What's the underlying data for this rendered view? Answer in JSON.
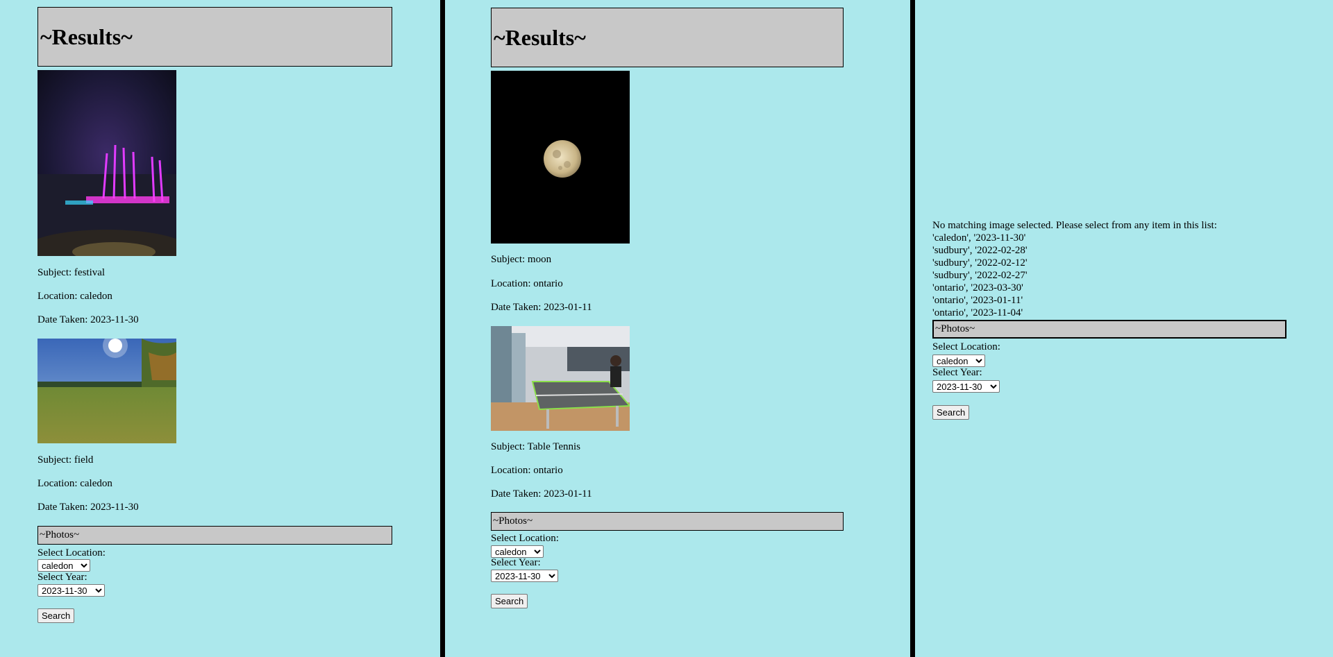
{
  "panel1": {
    "results_heading": "~Results~",
    "items": [
      {
        "subject": "Subject: festival",
        "location": "Location: caledon",
        "date": "Date Taken: 2023-11-30"
      },
      {
        "subject": "Subject: field",
        "location": "Location: caledon",
        "date": "Date Taken: 2023-11-30"
      }
    ],
    "form": {
      "photos_heading": "~Photos~",
      "location_label": "Select Location:",
      "location_value": "caledon",
      "year_label": "Select Year:",
      "year_value": "2023-11-30",
      "search_label": "Search"
    }
  },
  "panel2": {
    "results_heading": "~Results~",
    "items": [
      {
        "subject": "Subject: moon",
        "location": "Location: ontario",
        "date": "Date Taken: 2023-01-11"
      },
      {
        "subject": "Subject: Table Tennis",
        "location": "Location: ontario",
        "date": "Date Taken: 2023-01-11"
      }
    ],
    "form": {
      "photos_heading": "~Photos~",
      "location_label": "Select Location:",
      "location_value": "caledon",
      "year_label": "Select Year:",
      "year_value": "2023-11-30",
      "search_label": "Search"
    }
  },
  "panel3": {
    "message": "No matching image selected. Please select from any item in this list:",
    "list": [
      "'caledon', '2023-11-30'",
      "'sudbury', '2022-02-28'",
      "'sudbury', '2022-02-12'",
      "'sudbury', '2022-02-27'",
      "'ontario', '2023-03-30'",
      "'ontario', '2023-01-11'",
      "'ontario', '2023-11-04'"
    ],
    "form": {
      "photos_heading": "~Photos~",
      "location_label": "Select Location:",
      "location_value": "caledon",
      "year_label": "Select Year:",
      "year_value": "2023-11-30",
      "search_label": "Search"
    }
  }
}
